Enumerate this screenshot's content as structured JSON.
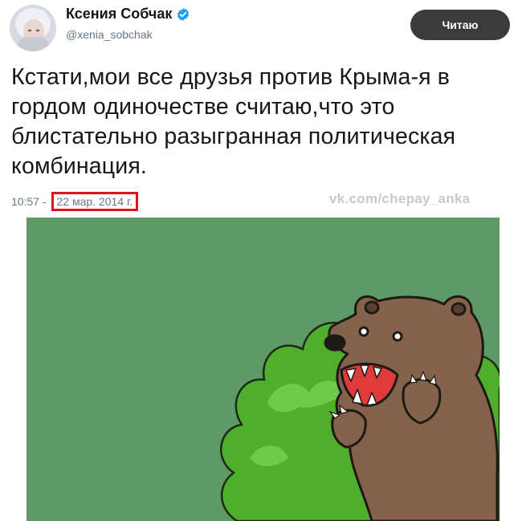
{
  "user": {
    "name": "Ксения Собчак",
    "handle": "@xenia_sobchak",
    "verified": true
  },
  "follow_button": {
    "label": "Читаю"
  },
  "tweet": {
    "lines": [
      "Кстати,мои все друзья против Крыма-я в",
      "гордом одиночестве считаю,что это",
      "блистательно разыгранная политическая",
      "комбинация."
    ]
  },
  "meta": {
    "time": "10:57",
    "separator": " - ",
    "date": "22 мар. 2014 г."
  },
  "watermark": "vk.com/chepay_anka",
  "colors": {
    "highlight_box": "#e0141e",
    "media_background": "#5e9a68",
    "bush": "#57b62f",
    "bear": "#84624b"
  },
  "icons": {
    "verified": "verified-badge-icon"
  }
}
